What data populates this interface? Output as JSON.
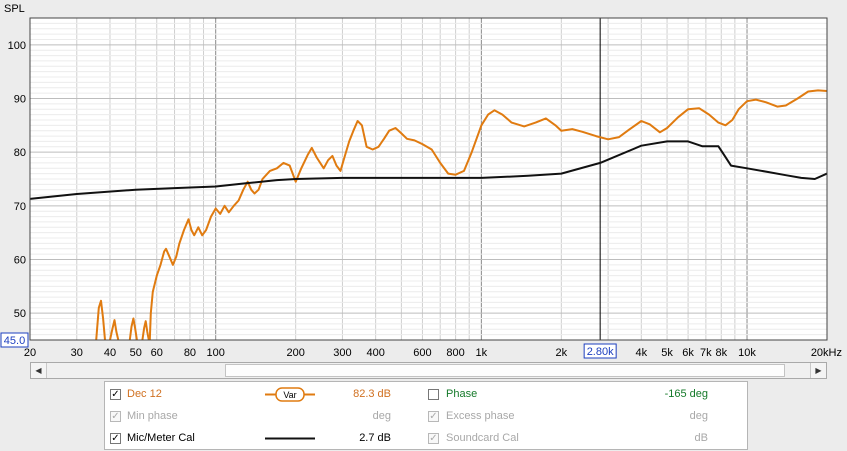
{
  "chart_data": {
    "type": "line",
    "ylabel": "SPL",
    "x_scale": "log",
    "xlim": [
      20,
      20000
    ],
    "ylim": [
      45,
      105
    ],
    "x_ticks": [
      {
        "value": 20,
        "label": "20"
      },
      {
        "value": 30,
        "label": "30"
      },
      {
        "value": 40,
        "label": "40"
      },
      {
        "value": 50,
        "label": "50"
      },
      {
        "value": 60,
        "label": "60"
      },
      {
        "value": 80,
        "label": "80"
      },
      {
        "value": 100,
        "label": "100"
      },
      {
        "value": 200,
        "label": "200"
      },
      {
        "value": 300,
        "label": "300"
      },
      {
        "value": 400,
        "label": "400"
      },
      {
        "value": 600,
        "label": "600"
      },
      {
        "value": 800,
        "label": "800"
      },
      {
        "value": 1000,
        "label": "1k"
      },
      {
        "value": 2000,
        "label": "2k"
      },
      {
        "value": 4000,
        "label": "4k"
      },
      {
        "value": 5000,
        "label": "5k"
      },
      {
        "value": 6000,
        "label": "6k"
      },
      {
        "value": 7000,
        "label": "7k"
      },
      {
        "value": 8000,
        "label": "8k"
      },
      {
        "value": 10000,
        "label": "10k"
      },
      {
        "value": 20000,
        "label": "20kHz"
      }
    ],
    "y_ticks": [
      50,
      60,
      70,
      80,
      90,
      100
    ],
    "y_min_label": "45.0",
    "cursor": {
      "x": 2800,
      "label": "2.80k"
    },
    "grid": true,
    "series": [
      {
        "name": "Dec 12",
        "color": "#e07b10",
        "segments": [
          [
            [
              35.5,
              45
            ],
            [
              36.3,
              51
            ],
            [
              37,
              52.3
            ],
            [
              37.7,
              49
            ],
            [
              38.3,
              45
            ]
          ],
          [
            [
              40,
              45
            ],
            [
              40.8,
              47
            ],
            [
              41.6,
              48.7
            ],
            [
              42.3,
              46.5
            ],
            [
              43,
              45
            ]
          ],
          [
            [
              47.5,
              45
            ],
            [
              48.2,
              47.5
            ],
            [
              49,
              49
            ],
            [
              49.8,
              47
            ],
            [
              50.5,
              45
            ]
          ],
          [
            [
              53,
              45
            ],
            [
              53.8,
              47.3
            ],
            [
              54.5,
              48.5
            ],
            [
              55.3,
              46.5
            ],
            [
              56,
              45
            ]
          ],
          [
            [
              56.5,
              45
            ],
            [
              57,
              50
            ],
            [
              58,
              54
            ],
            [
              60,
              57
            ],
            [
              62,
              59
            ],
            [
              64,
              61.5
            ],
            [
              65,
              62
            ],
            [
              67,
              60.5
            ],
            [
              69,
              59
            ],
            [
              71,
              60.5
            ],
            [
              73,
              63
            ],
            [
              76,
              65.5
            ],
            [
              79,
              67.5
            ],
            [
              81,
              65.5
            ],
            [
              83,
              64.5
            ],
            [
              86,
              66
            ],
            [
              89,
              64.5
            ],
            [
              92,
              65.5
            ],
            [
              96,
              68
            ],
            [
              100,
              69.5
            ],
            [
              104,
              68.5
            ],
            [
              108,
              70
            ],
            [
              112,
              68.8
            ],
            [
              117,
              70
            ],
            [
              122,
              71
            ],
            [
              127,
              73
            ],
            [
              132,
              74.5
            ],
            [
              136,
              73
            ],
            [
              140,
              72.3
            ],
            [
              145,
              73
            ],
            [
              150,
              75
            ],
            [
              160,
              76.5
            ],
            [
              170,
              77
            ],
            [
              180,
              78
            ],
            [
              190,
              77.5
            ],
            [
              200,
              74.5
            ],
            [
              210,
              77
            ],
            [
              222,
              79.5
            ],
            [
              230,
              80.8
            ],
            [
              240,
              79
            ],
            [
              255,
              77
            ],
            [
              265,
              78.5
            ],
            [
              275,
              79.3
            ],
            [
              285,
              77.5
            ],
            [
              295,
              76.5
            ],
            [
              305,
              79
            ],
            [
              318,
              82
            ],
            [
              330,
              84
            ],
            [
              342,
              85.8
            ],
            [
              355,
              85
            ],
            [
              370,
              81
            ],
            [
              390,
              80.5
            ],
            [
              410,
              81
            ],
            [
              430,
              82.5
            ],
            [
              450,
              84
            ],
            [
              475,
              84.5
            ],
            [
              500,
              83.5
            ],
            [
              525,
              82.5
            ],
            [
              560,
              82.2
            ],
            [
              600,
              81.5
            ],
            [
              650,
              80.5
            ],
            [
              700,
              78
            ],
            [
              750,
              76
            ],
            [
              800,
              75.8
            ],
            [
              860,
              76.5
            ],
            [
              920,
              80
            ],
            [
              1000,
              85
            ],
            [
              1060,
              87
            ],
            [
              1120,
              87.8
            ],
            [
              1200,
              87
            ],
            [
              1300,
              85.5
            ],
            [
              1450,
              84.8
            ],
            [
              1600,
              85.5
            ],
            [
              1750,
              86.3
            ],
            [
              1900,
              85
            ],
            [
              2000,
              84
            ],
            [
              2200,
              84.3
            ],
            [
              2400,
              83.8
            ],
            [
              2700,
              83
            ],
            [
              3000,
              82.4
            ],
            [
              3300,
              82.8
            ],
            [
              3600,
              84.2
            ],
            [
              4000,
              85.8
            ],
            [
              4300,
              85.2
            ],
            [
              4700,
              83.7
            ],
            [
              5000,
              84.5
            ],
            [
              5500,
              86.5
            ],
            [
              6000,
              88
            ],
            [
              6600,
              88.2
            ],
            [
              7200,
              87
            ],
            [
              7800,
              85.5
            ],
            [
              8300,
              85
            ],
            [
              8800,
              86
            ],
            [
              9300,
              88
            ],
            [
              10000,
              89.5
            ],
            [
              10800,
              89.8
            ],
            [
              11800,
              89.3
            ],
            [
              13000,
              88.5
            ],
            [
              14000,
              88.7
            ],
            [
              15500,
              90
            ],
            [
              17000,
              91.3
            ],
            [
              18500,
              91.5
            ],
            [
              20000,
              91.4
            ]
          ]
        ]
      },
      {
        "name": "Mic/Meter Cal",
        "color": "#111111",
        "segments": [
          [
            [
              20,
              71.3
            ],
            [
              30,
              72.2
            ],
            [
              50,
              73
            ],
            [
              70,
              73.3
            ],
            [
              100,
              73.6
            ],
            [
              130,
              74.2
            ],
            [
              170,
              74.8
            ],
            [
              200,
              75
            ],
            [
              300,
              75.2
            ],
            [
              500,
              75.2
            ],
            [
              700,
              75.2
            ],
            [
              1000,
              75.2
            ],
            [
              1500,
              75.6
            ],
            [
              2000,
              76
            ],
            [
              2800,
              78
            ],
            [
              4000,
              81.2
            ],
            [
              5000,
              82
            ],
            [
              6000,
              82
            ],
            [
              6800,
              81.1
            ],
            [
              7800,
              81.1
            ],
            [
              8200,
              79.5
            ],
            [
              8700,
              77.5
            ],
            [
              10000,
              77
            ],
            [
              12000,
              76.3
            ],
            [
              14000,
              75.7
            ],
            [
              16000,
              75.2
            ],
            [
              18000,
              75
            ],
            [
              20000,
              76
            ]
          ]
        ]
      }
    ]
  },
  "legend": {
    "rows": [
      {
        "checked": true,
        "enabled": true,
        "name": "Dec 12",
        "name_color": "#d07020",
        "value": "82.3 dB",
        "value_color": "#d07020",
        "right_checked": false,
        "right_enabled": true,
        "right_name": "Phase",
        "right_name_color": "#157a2a",
        "right_value": "-165 deg",
        "right_value_color": "#157a2a",
        "smoothing": "Var"
      },
      {
        "checked": true,
        "enabled": false,
        "name": "Min phase",
        "value": "deg",
        "right_checked": true,
        "right_enabled": false,
        "right_name": "Excess phase",
        "right_value": "deg"
      },
      {
        "checked": true,
        "enabled": true,
        "name": "Mic/Meter Cal",
        "name_color": "#000000",
        "value": "2.7 dB",
        "value_color": "#000000",
        "right_checked": true,
        "right_enabled": false,
        "right_name": "Soundcard Cal",
        "right_value": "dB"
      }
    ]
  },
  "scrollbar": {
    "left_arrow": "◀",
    "right_arrow": "▶"
  },
  "check_mark": "✓"
}
